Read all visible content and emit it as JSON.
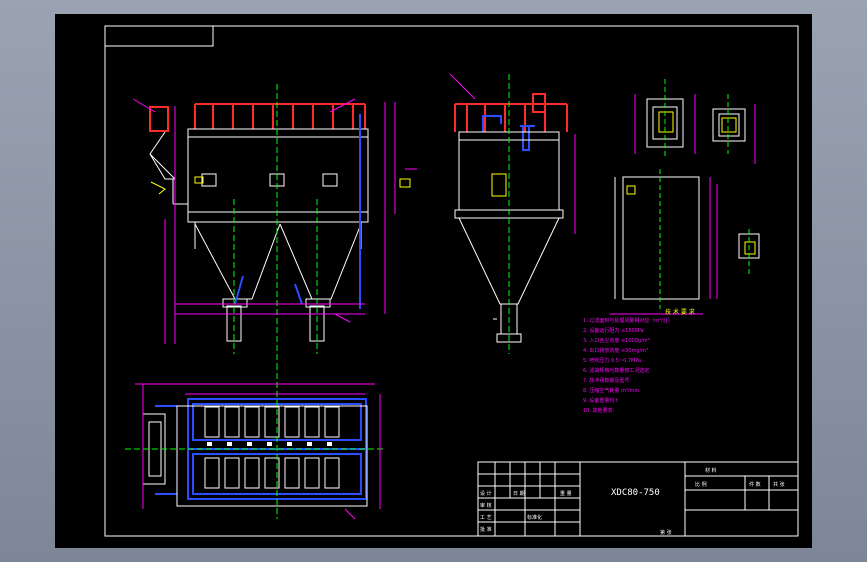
{
  "drawing": {
    "model": "XDC80-750",
    "tech_heading": "技 术 要 求",
    "title_cells": {
      "scale_label": "比 例",
      "ratio_label": "件 数",
      "material_label": "材 料",
      "sheet_label": "共 张",
      "designer_label": "设 计",
      "checker_label": "审 核",
      "process_label": "工 艺",
      "approve_label": "批 准",
      "weight_label": "重 量",
      "sheet_no_label": "第 张",
      "date_label": "日 期",
      "design_no_label": "标准化"
    },
    "tech_notes": [
      "1. 过滤面积与处理风量相对应（m²/台）",
      "2. 设备运行阻力 ≤1500Pa",
      "3. 入口含尘浓度 ≤1000g/m³",
      "4. 出口排放浓度 ≤30mg/m³",
      "5. 喷吹压力 0.5~0.7MPa",
      "6. 滤袋规格与数量按工况选定",
      "7. 脉冲阀数量及型号",
      "8. 压缩空气耗量 m³/min",
      "9. 设备重量约 t",
      "10. 其他要求："
    ]
  },
  "colors": {
    "background": "#000000",
    "frame": "#ffffff",
    "structure": "#ffffff",
    "dimension": "#ff00ff",
    "accent_red": "#ff2a2a",
    "accent_blue": "#2a4dff",
    "centerline": "#00ff00",
    "text": "#ffff00",
    "note": "#ff00ff"
  }
}
